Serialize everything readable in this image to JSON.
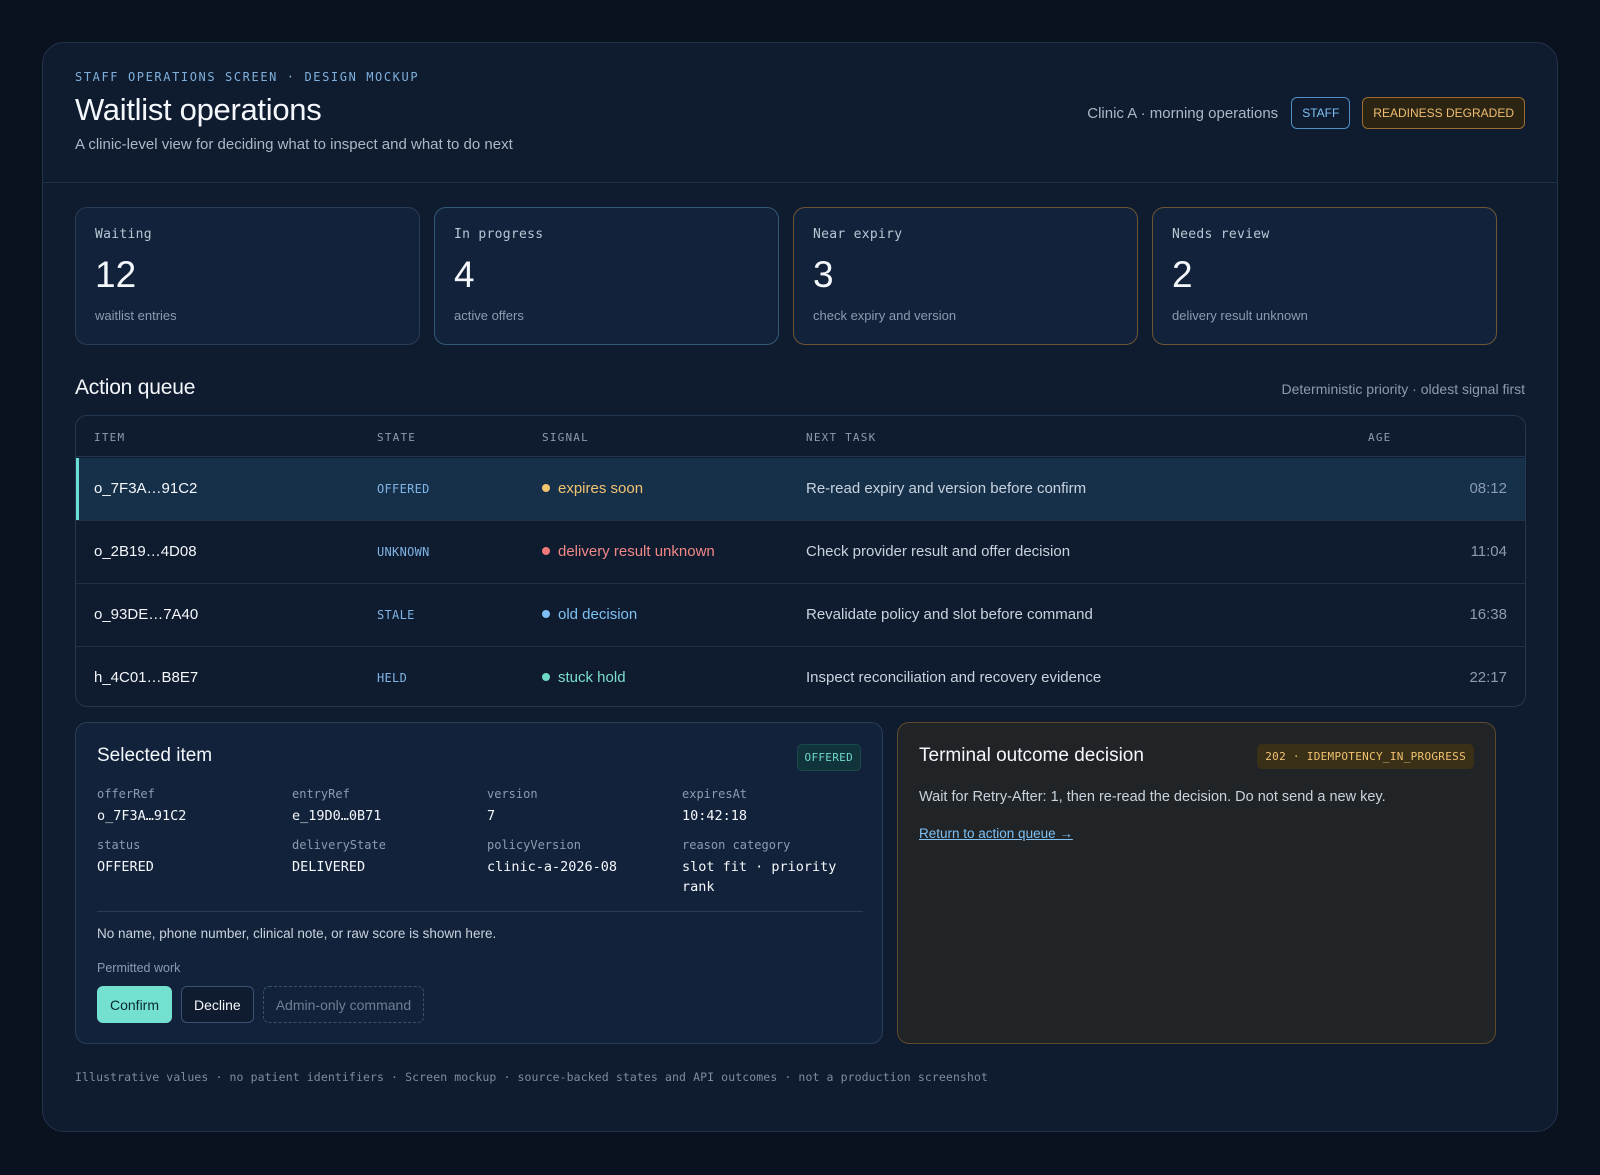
{
  "header": {
    "eyebrow": "STAFF OPERATIONS SCREEN · DESIGN MOCKUP",
    "title": "Waitlist operations",
    "subtitle": "A clinic-level view for deciding what to inspect and what to do next",
    "clinic": "Clinic A · morning operations",
    "role_badge": "STAFF",
    "readiness_badge": "READINESS DEGRADED"
  },
  "stats": [
    {
      "label": "Waiting",
      "value": "12",
      "note": "waitlist entries"
    },
    {
      "label": "In progress",
      "value": "4",
      "note": "active offers"
    },
    {
      "label": "Near expiry",
      "value": "3",
      "note": "check expiry and version"
    },
    {
      "label": "Needs review",
      "value": "2",
      "note": "delivery result unknown"
    }
  ],
  "queue": {
    "title": "Action queue",
    "note": "Deterministic priority · oldest signal first",
    "columns": [
      "ITEM",
      "STATE",
      "SIGNAL",
      "NEXT TASK",
      "AGE"
    ],
    "rows": [
      {
        "item": "o_7F3A…91C2",
        "state": "OFFERED",
        "signal": "expires soon",
        "task": "Re-read expiry and version before confirm",
        "age": "08:12"
      },
      {
        "item": "o_2B19…4D08",
        "state": "UNKNOWN",
        "signal": "delivery result unknown",
        "task": "Check provider result and offer decision",
        "age": "11:04"
      },
      {
        "item": "o_93DE…7A40",
        "state": "STALE",
        "signal": "old decision",
        "task": "Revalidate policy and slot before command",
        "age": "16:38"
      },
      {
        "item": "h_4C01…B8E7",
        "state": "HELD",
        "signal": "stuck hold",
        "task": "Inspect reconciliation and recovery evidence",
        "age": "22:17"
      }
    ]
  },
  "selected": {
    "title": "Selected item",
    "badge": "OFFERED",
    "fields": [
      {
        "key": "offerRef",
        "value": "o_7F3A…91C2"
      },
      {
        "key": "entryRef",
        "value": "e_19D0…0B71"
      },
      {
        "key": "version",
        "value": "7"
      },
      {
        "key": "expiresAt",
        "value": "10:42:18"
      },
      {
        "key": "status",
        "value": "OFFERED"
      },
      {
        "key": "deliveryState",
        "value": "DELIVERED"
      },
      {
        "key": "policyVersion",
        "value": "clinic-a-2026-08"
      },
      {
        "key": "reason category",
        "value": "slot fit · priority rank"
      }
    ],
    "privacy_note": "No name, phone number, clinical note, or raw score is shown here.",
    "permitted_label": "Permitted work",
    "buttons": {
      "confirm": "Confirm",
      "decline": "Decline",
      "admin": "Admin-only command"
    }
  },
  "terminal": {
    "title": "Terminal outcome decision",
    "code": "202 · IDEMPOTENCY_IN_PROGRESS",
    "message": "Wait for Retry-After: 1, then re-read the decision. Do not send a new key.",
    "link": "Return to action queue →"
  },
  "footer": "Illustrative values · no patient identifiers · Screen mockup · source-backed states and API outcomes · not a production screenshot",
  "colors": {
    "accent_teal": "#73e0d0",
    "warning_amber": "#f2c370",
    "error_red": "#f08888",
    "info_blue": "#7fc1f5"
  }
}
